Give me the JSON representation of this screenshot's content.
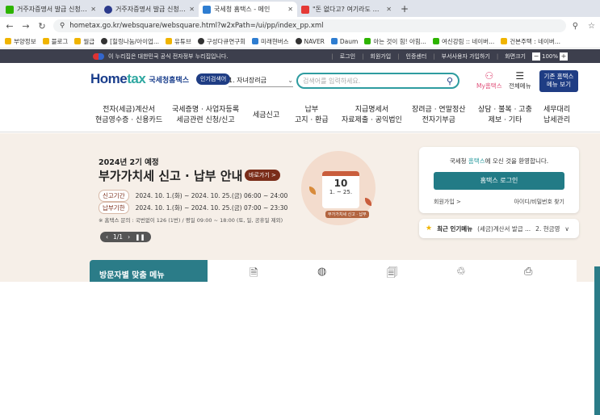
{
  "browser": {
    "tabs": [
      {
        "title": "거주자증명서 발급 신청 : 네이버",
        "active": false,
        "favicon_color": "#2db400"
      },
      {
        "title": "거주자증명서 발급 신청 | 민원",
        "active": false,
        "favicon_color": "#2b3a8c"
      },
      {
        "title": "국세청 홈택스 - 메인",
        "active": true,
        "favicon_color": "#2e7dd1"
      },
      {
        "title": "\"돈 없다고? 여기라도 사라\" 스",
        "active": false,
        "favicon_color": "#e53935"
      }
    ],
    "new_tab": "+",
    "url": "hometax.go.kr/websquare/websquare.html?w2xPath=/ui/pp/index_pp.xml",
    "bookmarks": [
      {
        "label": "부양정보",
        "favicon_color": "#f0b400"
      },
      {
        "label": "블로그",
        "favicon_color": "#f0b400"
      },
      {
        "label": "월급",
        "favicon_color": "#f0b400"
      },
      {
        "label": "[힐링나눔/아이업...",
        "favicon_color": "#333333"
      },
      {
        "label": "유튜브",
        "favicon_color": "#f0b400"
      },
      {
        "label": "구성다큐연구회",
        "favicon_color": "#333333"
      },
      {
        "label": "미래현버스",
        "favicon_color": "#2e7dd1"
      },
      {
        "label": "NAVER",
        "favicon_color": "#333333"
      },
      {
        "label": "Daum",
        "favicon_color": "#2e7dd1"
      },
      {
        "label": "아는 것이 힘! 아힘...",
        "favicon_color": "#2db400"
      },
      {
        "label": "여신강림 :: 네이버...",
        "favicon_color": "#2db400"
      },
      {
        "label": "건본주택 : 네이버...",
        "favicon_color": "#f0b400"
      }
    ]
  },
  "gov_banner": {
    "text": "이 누리집은 대한민국 공식 전자정부 누리집입니다.",
    "links": [
      "로그인",
      "회원가입",
      "인증센터",
      "부서사용자 가입하기",
      "화면크기"
    ],
    "zoom": "100%",
    "zoom_minus": "−",
    "zoom_plus": "+"
  },
  "header": {
    "logo_main": "Home",
    "logo_accent": "tax",
    "logo_sub": "국세청홈택스",
    "popular_badge": "인기검색어",
    "popular_selected": "1.  자녀장려금",
    "search_placeholder": "검색어를 입력하세요.",
    "my_label": "My홈택스",
    "all_menu_label": "전체메뉴",
    "old_button_line1": "기존 홈택스",
    "old_button_line2": "메뉴 보기"
  },
  "gnb": [
    {
      "l1": "전자(세금)계산서",
      "l2": "현금영수증 · 신용카드"
    },
    {
      "l1": "국세증명 · 사업자등록",
      "l2": "세금관련 신청/신고"
    },
    {
      "l1": "세금신고",
      "l2": ""
    },
    {
      "l1": "납부",
      "l2": "고지 · 환급"
    },
    {
      "l1": "지급명세서",
      "l2": "자료제출 · 공익법인"
    },
    {
      "l1": "장려금 · 연말정산",
      "l2": "전자기부금"
    },
    {
      "l1": "상담 · 불복 · 고충",
      "l2": "제보 · 기타"
    },
    {
      "l1": "세무대리",
      "l2": "납세관리"
    }
  ],
  "promo": {
    "line1": "2024년 2기 예정",
    "line2": "부가가치세 신고 · 납부 안내",
    "shortcut": "바로가기 >",
    "period_tag": "신고기간",
    "period": "2024. 10. 1.(화) ~ 2024. 10. 25.(금) 06:00 ~ 24:00",
    "payment_tag": "납부기한",
    "payment": "2024. 10. 1.(화) ~ 2024. 10. 25.(금) 07:00 ~ 23:30",
    "note": "※ 홈택스 문의 : 국번없이 126 (1번) / 평일 09:00 ~ 18:00 (토, 일, 공휴일 제외)",
    "pager": "1/1",
    "cal_day": "10",
    "cal_range": "1. ~ 25.",
    "cal_tag": "부가가치세 신고 · 납부"
  },
  "login": {
    "welcome_pre": "국세청 ",
    "welcome_accent": "홈택스",
    "welcome_post": "에 오신 것을 환영합니다.",
    "login_button": "홈택스 로그인",
    "join": "회원가입 >",
    "find": "아이디/비밀번호 찾기"
  },
  "popular_menu": {
    "label": "최근 인기메뉴",
    "item1": "(세금)계산서 발급 ...",
    "item2": "2.  현금영",
    "arrow": "∨"
  },
  "visitor_menu": "방문자별 맞춤 메뉴"
}
